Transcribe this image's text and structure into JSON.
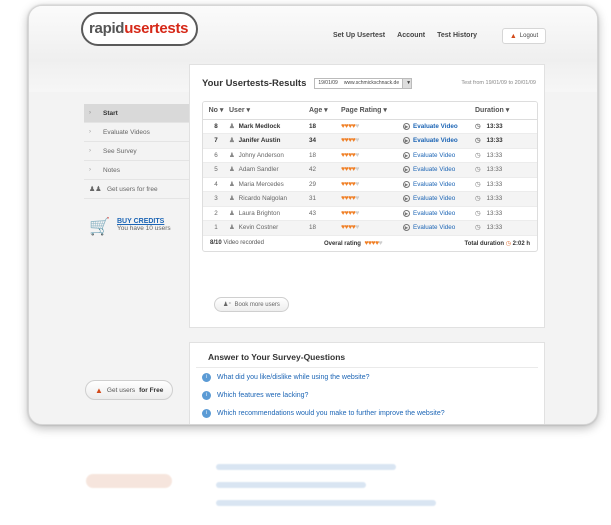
{
  "header": {
    "logo_part1": "rapid",
    "logo_part2": "usertests",
    "nav": [
      "Set Up Usertest",
      "Account",
      "Test History"
    ],
    "logout_label": "Logout"
  },
  "sidebar": {
    "items": [
      {
        "label": "Start",
        "active": true,
        "icon": "chevron-right-icon"
      },
      {
        "label": "Evaluate Videos",
        "active": false,
        "icon": "chevron-right-icon"
      },
      {
        "label": "See Survey",
        "active": false,
        "icon": "chevron-right-icon"
      },
      {
        "label": "Notes",
        "active": false,
        "icon": "chevron-right-icon"
      },
      {
        "label": "Get users for free",
        "active": false,
        "icon": "users-icon"
      }
    ],
    "buy_credits": "BUY CREDITS",
    "credits_text": "You have 10 users",
    "get_users_prefix": "Get users",
    "get_users_bold": "for Free"
  },
  "results": {
    "title": "Your Usertests-Results",
    "date_value": "19/01/09",
    "site_value": "www.schmickschnack.de",
    "range_text": "Test from 19/01/09 to 20/01/09",
    "columns": [
      "No",
      "User",
      "Age",
      "Page Rating",
      "",
      "Duration"
    ],
    "rows": [
      {
        "no": "8",
        "user": "Mark Medlock",
        "age": "18",
        "rating": 4,
        "action": "Evaluate Video",
        "duration": "13:33",
        "bold": true
      },
      {
        "no": "7",
        "user": "Janifer Austin",
        "age": "34",
        "rating": 4,
        "action": "Evaluate Video",
        "duration": "13:33",
        "bold": true
      },
      {
        "no": "6",
        "user": "Johny Anderson",
        "age": "18",
        "rating": 4,
        "action": "Evaluate Video",
        "duration": "13:33",
        "bold": false
      },
      {
        "no": "5",
        "user": "Adam Sandler",
        "age": "42",
        "rating": 4,
        "action": "Evaluate Video",
        "duration": "13:33",
        "bold": false
      },
      {
        "no": "4",
        "user": "Maria Mercedes",
        "age": "29",
        "rating": 4,
        "action": "Evaluate Video",
        "duration": "13:33",
        "bold": false
      },
      {
        "no": "3",
        "user": "Ricardo Nalgolan",
        "age": "31",
        "rating": 4,
        "action": "Evaluate Video",
        "duration": "13:33",
        "bold": false
      },
      {
        "no": "2",
        "user": "Laura Brighton",
        "age": "43",
        "rating": 4,
        "action": "Evaluate Video",
        "duration": "13:33",
        "bold": false
      },
      {
        "no": "1",
        "user": "Kevin Costner",
        "age": "18",
        "rating": 4,
        "action": "Evaluate Video",
        "duration": "13:33",
        "bold": false
      }
    ],
    "rating_max": 5,
    "recorded_count": "8/10",
    "recorded_label": "Video recorded",
    "overall_label": "Overal rating",
    "overall_rating": 4,
    "total_label": "Total duration",
    "total_value": "2:02 h",
    "book_label": "Book more users"
  },
  "survey": {
    "title": "Answer to Your Survey-Questions",
    "questions": [
      "What did you like/dislike while using the website?",
      "Which features were lacking?",
      "Which recommendations would you make to further improve the website?"
    ]
  },
  "colors": {
    "accent": "#d62818",
    "link": "#1c65b5",
    "rating": "#f07f25"
  }
}
